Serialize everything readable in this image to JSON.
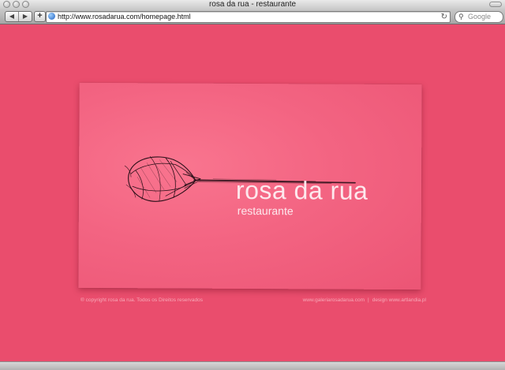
{
  "window": {
    "title": "rosa da rua - restaurante"
  },
  "toolbar": {
    "back_icon": "◀",
    "forward_icon": "▶",
    "add_icon": "+",
    "url": "http://www.rosadarua.com/homepage.html",
    "reload_icon": "↻",
    "search_placeholder": "Google"
  },
  "page": {
    "logo_title": "rosa da rua",
    "logo_subtitle": "restaurante",
    "footer": {
      "copyright": "® copyright rosa da rua. Todos os Direitos reservados",
      "gallery_link": "www.galeriarosadarua.com",
      "separator": "|",
      "design_link": "design www.artlandia.pl"
    }
  },
  "colors": {
    "page_background": "#ea4d6d",
    "card_background": "#f36482",
    "logo_text": "#fde8ed",
    "footer_text": "#f7a8b7"
  }
}
